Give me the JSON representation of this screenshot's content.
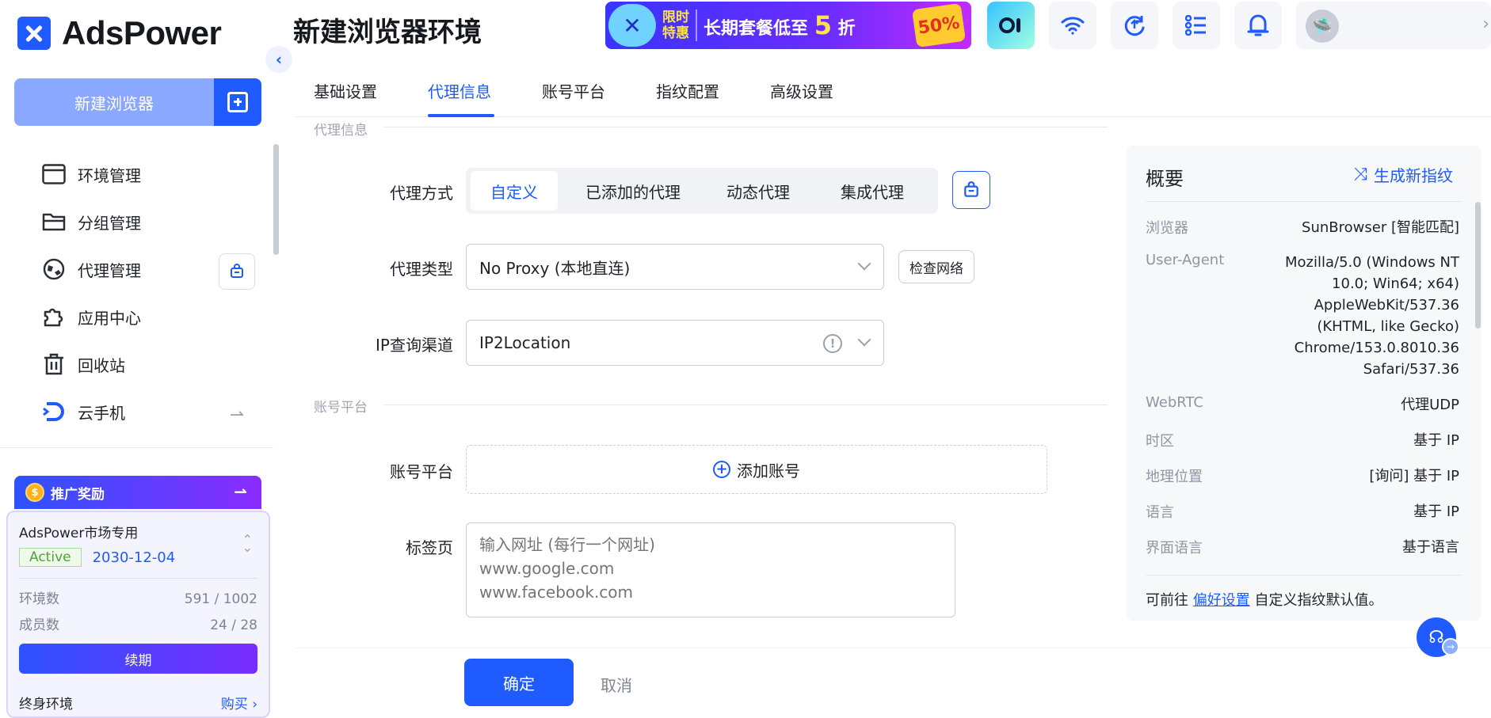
{
  "app": {
    "brand": "AdsPower"
  },
  "colors": {
    "accent": "#1f5bff",
    "active_green": "#4ca534",
    "promo_gradient_start": "#2d52ff",
    "promo_gradient_end": "#8a2cff"
  },
  "sidebar": {
    "new_browser_label": "新建浏览器",
    "items": [
      {
        "label": "环境管理",
        "icon": "window-icon"
      },
      {
        "label": "分组管理",
        "icon": "folder-icon"
      },
      {
        "label": "代理管理",
        "icon": "proxy-icon"
      },
      {
        "label": "应用中心",
        "icon": "puzzle-icon"
      },
      {
        "label": "回收站",
        "icon": "trash-icon"
      },
      {
        "label": "云手机",
        "icon": "cloud-phone-icon"
      }
    ],
    "promo_title": "推广奖励",
    "plan": {
      "name": "AdsPower市场专用",
      "status": "Active",
      "expiry": "2030-12-04",
      "env_label": "环境数",
      "env_value": "591 / 1002",
      "member_label": "成员数",
      "member_value": "24 / 28",
      "renew_label": "续期",
      "lifetime_label": "终身环境",
      "buy_label": "购买"
    }
  },
  "header": {
    "title": "新建浏览器环境",
    "banner": {
      "tag_line1": "限时",
      "tag_line2": "特惠",
      "text": "长期套餐低至",
      "discount_num": "5",
      "discount_unit": "折",
      "badge": "50%"
    }
  },
  "tabs": [
    {
      "label": "基础设置"
    },
    {
      "label": "代理信息"
    },
    {
      "label": "账号平台"
    },
    {
      "label": "指纹配置"
    },
    {
      "label": "高级设置"
    }
  ],
  "form": {
    "proxy_section": "代理信息",
    "proxy_mode_label": "代理方式",
    "proxy_modes": [
      "自定义",
      "已添加的代理",
      "动态代理",
      "集成代理"
    ],
    "proxy_type_label": "代理类型",
    "proxy_type_value": "No Proxy (本地直连)",
    "check_network_label": "检查网络",
    "ip_channel_label": "IP查询渠道",
    "ip_channel_value": "IP2Location",
    "account_section": "账号平台",
    "account_label": "账号平台",
    "add_account_label": "添加账号",
    "tabs_label": "标签页",
    "tabs_placeholder": "输入网址 (每行一个网址)\nwww.google.com\nwww.facebook.com",
    "ok_label": "确定",
    "cancel_label": "取消"
  },
  "summary": {
    "title": "概要",
    "generate_label": "生成新指纹",
    "rows": [
      {
        "key": "浏览器",
        "value": "SunBrowser [智能匹配]"
      },
      {
        "key": "User-Agent",
        "value": "Mozilla/5.0 (Windows NT 10.0; Win64; x64) AppleWebKit/537.36 (KHTML, like Gecko) Chrome/153.0.8010.36 Safari/537.36"
      },
      {
        "key": "WebRTC",
        "value": "代理UDP"
      },
      {
        "key": "时区",
        "value": "基于 IP"
      },
      {
        "key": "地理位置",
        "value": "[询问] 基于 IP"
      },
      {
        "key": "语言",
        "value": "基于 IP"
      },
      {
        "key": "界面语言",
        "value": "基于语言"
      }
    ],
    "footer_prefix": "可前往",
    "footer_link": "偏好设置",
    "footer_suffix": "自定义指纹默认值。"
  }
}
